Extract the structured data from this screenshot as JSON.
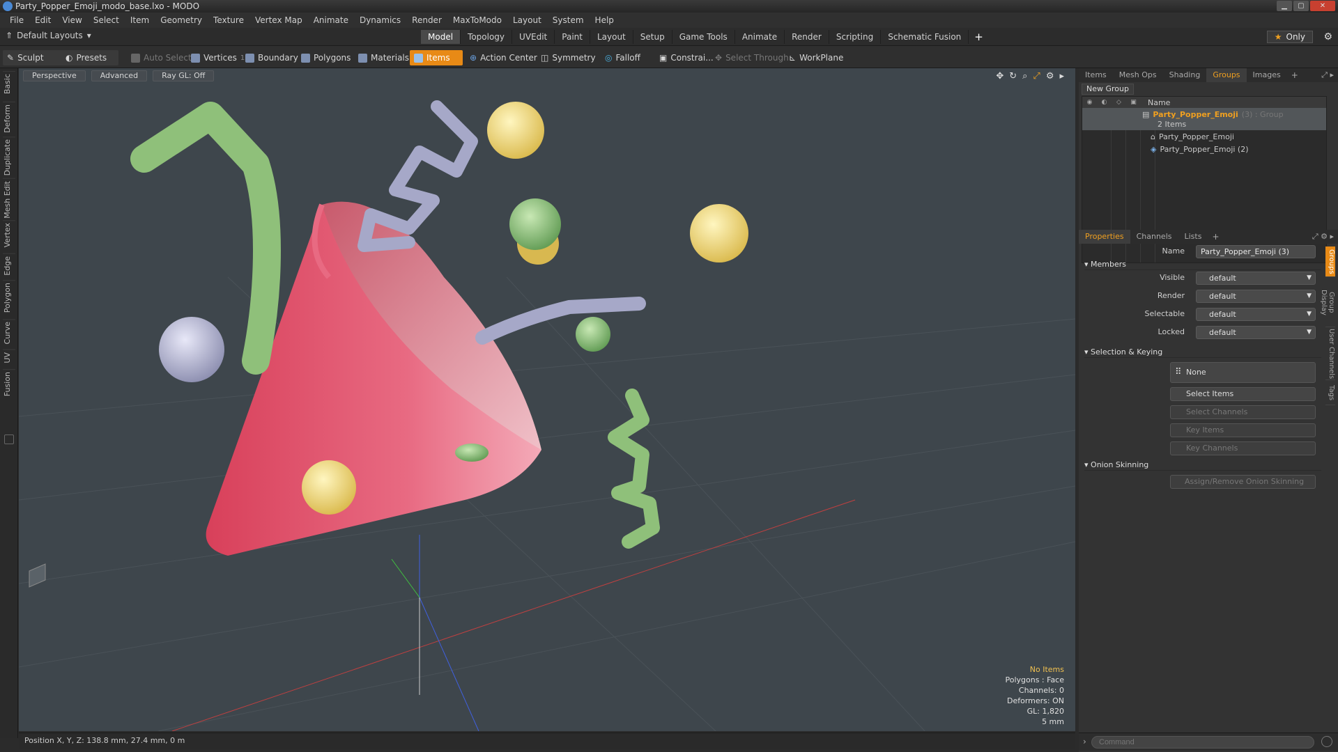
{
  "window": {
    "title": "Party_Popper_Emoji_modo_base.lxo - MODO"
  },
  "menu": [
    "File",
    "Edit",
    "View",
    "Select",
    "Item",
    "Geometry",
    "Texture",
    "Vertex Map",
    "Animate",
    "Dynamics",
    "Render",
    "MaxToModo",
    "Layout",
    "System",
    "Help"
  ],
  "layout_bar": {
    "default_layouts": "Default Layouts",
    "tabs": [
      "Model",
      "Topology",
      "UVEdit",
      "Paint",
      "Layout",
      "Setup",
      "Game Tools",
      "Animate",
      "Render",
      "Scripting",
      "Schematic Fusion"
    ],
    "active_tab": "Model",
    "add": "+",
    "only": "Only"
  },
  "toolbar": {
    "sculpt": "Sculpt",
    "presets": "Presets",
    "auto_select": "Auto Select",
    "vertices": "Vertices",
    "vertices_count": "1",
    "boundary": "Boundary",
    "polygons": "Polygons",
    "materials": "Materials",
    "items": "Items",
    "action_center": "Action Center",
    "symmetry": "Symmetry",
    "falloff": "Falloff",
    "constraints": "Constrai...",
    "select_through": "Select Through",
    "workplane": "WorkPlane"
  },
  "left_tabs": [
    "Basic",
    "Deform",
    "Duplicate",
    "Mesh Edit",
    "Vertex",
    "Edge",
    "Polygon",
    "Curve",
    "UV",
    "Fusion"
  ],
  "viewport": {
    "view_mode": "Perspective",
    "shading": "Advanced",
    "raygl": "Ray GL: Off",
    "stats": {
      "items": "No Items",
      "polygons": "Polygons : Face",
      "channels": "Channels: 0",
      "deformers": "Deformers: ON",
      "gl": "GL: 1,820",
      "scale": "5 mm"
    },
    "colors": {
      "background": "#3e464c",
      "cone": "#e0506a",
      "green": "#8fc07a",
      "yellow": "#f0df80",
      "lavender": "#a6a8c8"
    }
  },
  "status": {
    "position": "Position X, Y, Z:   138.8 mm, 27.4 mm, 0 m"
  },
  "top_panel": {
    "tabs": [
      "Items",
      "Mesh Ops",
      "Shading",
      "Groups",
      "Images"
    ],
    "active_tab": "Groups",
    "add": "+",
    "new_group": "New Group",
    "columns": {
      "name": "Name"
    },
    "group": {
      "name": "Party_Popper_Emoji",
      "suffix": "(3) : Group",
      "count": "2 Items"
    },
    "children": [
      "Party_Popper_Emoji",
      "Party_Popper_Emoji (2)"
    ]
  },
  "properties": {
    "tabs": [
      "Properties",
      "Channels",
      "Lists"
    ],
    "active_tab": "Properties",
    "add": "+",
    "name_label": "Name",
    "name_value": "Party_Popper_Emoji (3)",
    "members_title": "Members",
    "members": [
      {
        "label": "Visible",
        "value": "default"
      },
      {
        "label": "Render",
        "value": "default"
      },
      {
        "label": "Selectable",
        "value": "default"
      },
      {
        "label": "Locked",
        "value": "default"
      }
    ],
    "selection_title": "Selection & Keying",
    "none_btn": "None",
    "buttons": [
      "Select Items",
      "Select Channels",
      "Key Items",
      "Key Channels"
    ],
    "onion_title": "Onion Skinning",
    "onion_btn": "Assign/Remove Onion Skinning",
    "side_tabs": [
      "Groups",
      "Group Display",
      "User Channels",
      "Tags"
    ]
  },
  "command": {
    "placeholder": "Command"
  }
}
